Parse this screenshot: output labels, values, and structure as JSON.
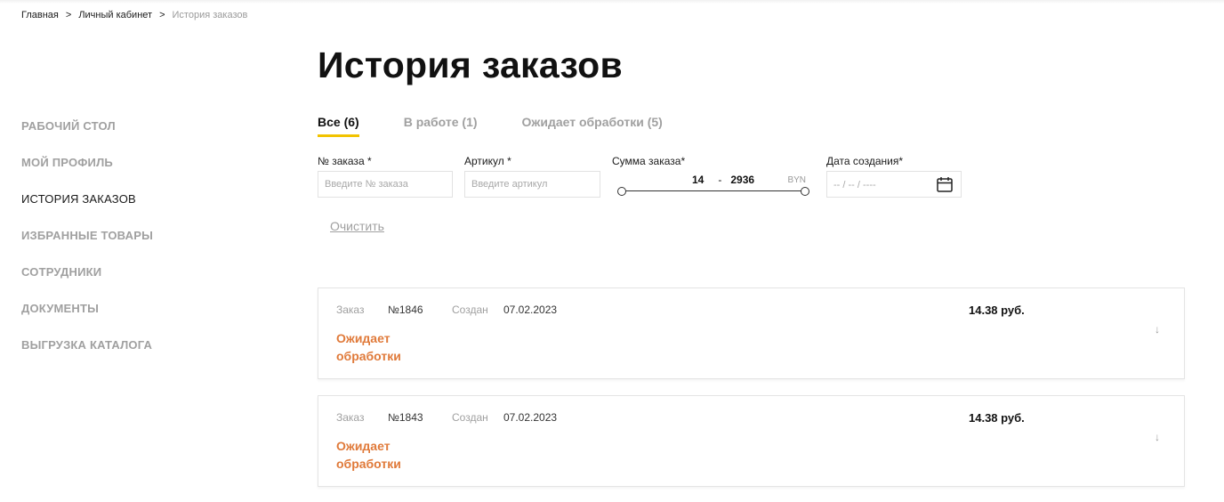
{
  "breadcrumb": {
    "items": [
      "Главная",
      "Личный кабинет"
    ],
    "separator": ">",
    "current": "История заказов"
  },
  "page_title": "История заказов",
  "sidebar": {
    "items": [
      {
        "label": "РАБОЧИЙ СТОЛ",
        "active": false
      },
      {
        "label": "МОЙ ПРОФИЛЬ",
        "active": false
      },
      {
        "label": "ИСТОРИЯ ЗАКАЗОВ",
        "active": true
      },
      {
        "label": "ИЗБРАННЫЕ ТОВАРЫ",
        "active": false
      },
      {
        "label": "СОТРУДНИКИ",
        "active": false
      },
      {
        "label": "ДОКУМЕНТЫ",
        "active": false
      },
      {
        "label": "ВЫГРУЗКА КАТАЛОГА",
        "active": false
      }
    ]
  },
  "tabs": [
    {
      "label": "Все (6)",
      "active": true
    },
    {
      "label": "В работе (1)",
      "active": false
    },
    {
      "label": "Ожидает обработки (5)",
      "active": false
    }
  ],
  "filters": {
    "order_number": {
      "label": "№ заказа *",
      "placeholder": "Введите № заказа",
      "value": ""
    },
    "article": {
      "label": "Артикул *",
      "placeholder": "Введите артикул",
      "value": ""
    },
    "sum": {
      "label": "Сумма заказа*",
      "min": "14",
      "separator": "-",
      "max": "2936",
      "currency": "BYN"
    },
    "date": {
      "label": "Дата создания*",
      "placeholder": "-- / -- / ----"
    },
    "clear_label": "Очистить"
  },
  "orders": [
    {
      "order_label": "Заказ",
      "number": "№1846",
      "created_label": "Создан",
      "date": "07.02.2023",
      "status": "Ожидает обработки",
      "sum": "14.38 руб.",
      "arrow": "↓"
    },
    {
      "order_label": "Заказ",
      "number": "№1843",
      "created_label": "Создан",
      "date": "07.02.2023",
      "status": "Ожидает обработки",
      "sum": "14.38 руб.",
      "arrow": "↓"
    }
  ],
  "colors": {
    "accent_underline": "#f2c300",
    "status_pending": "#e07a3a",
    "muted_text": "#a0a0a0"
  },
  "icons": {
    "date_picker": "calendar-icon",
    "expand": "arrow-down-icon"
  }
}
